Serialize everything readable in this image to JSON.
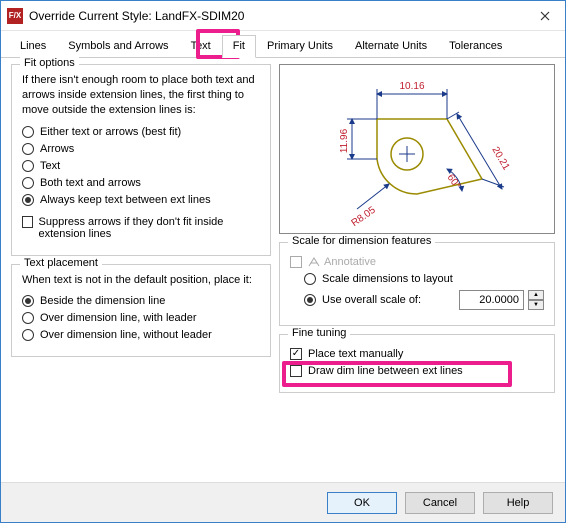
{
  "window": {
    "title": "Override Current Style: LandFX-SDIM20"
  },
  "tabs": {
    "items": [
      "Lines",
      "Symbols and Arrows",
      "Text",
      "Fit",
      "Primary Units",
      "Alternate Units",
      "Tolerances"
    ],
    "active": "Fit"
  },
  "fit_options": {
    "title": "Fit options",
    "desc": "If there isn't enough room to place both text and arrows inside extension lines, the first thing to move outside the extension lines is:",
    "radios": {
      "either": "Either text or arrows (best fit)",
      "arrows": "Arrows",
      "text": "Text",
      "both": "Both text and arrows",
      "always": "Always keep text between ext lines"
    },
    "selected": "always",
    "suppress": "Suppress arrows if they don't fit inside extension lines"
  },
  "text_placement": {
    "title": "Text placement",
    "desc": "When text is not in the default position, place it:",
    "radios": {
      "beside": "Beside the dimension line",
      "over_leader": "Over dimension line, with leader",
      "over_noleader": "Over dimension line, without leader"
    },
    "selected": "beside"
  },
  "preview": {
    "dims": {
      "top": "10.16",
      "left": "11.96",
      "radius": "R8.05",
      "angle": "60°",
      "diag": "20.21"
    }
  },
  "scale": {
    "title": "Scale for dimension features",
    "annotative_label": "Annotative",
    "radios": {
      "layout": "Scale dimensions to layout",
      "overall": "Use overall scale of:"
    },
    "selected": "overall",
    "value": "20.0000"
  },
  "fine_tuning": {
    "title": "Fine tuning",
    "place_manual": "Place text manually",
    "draw_dim": "Draw dim line between ext lines"
  },
  "buttons": {
    "ok": "OK",
    "cancel": "Cancel",
    "help": "Help"
  }
}
